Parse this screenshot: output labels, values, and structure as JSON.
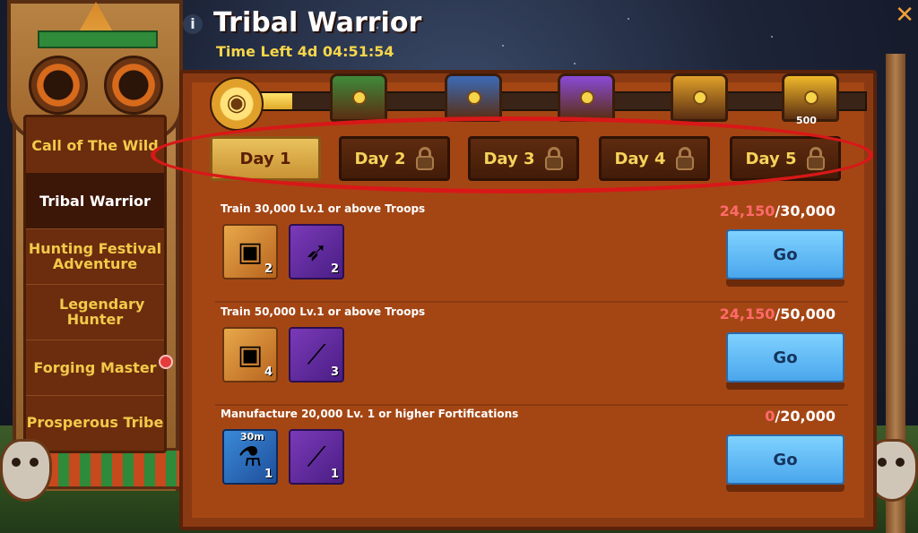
{
  "window": {
    "title": "Tribal Warrior",
    "time_left_label": "Time Left",
    "time_left_value": "4d 04:51:54",
    "close_label": "✕",
    "info_label": "i"
  },
  "sidebar": {
    "items": [
      {
        "label": "Call of The Wild",
        "active": false
      },
      {
        "label": "Tribal Warrior",
        "active": true
      },
      {
        "label": "Hunting Festival Adventure",
        "active": false
      },
      {
        "label": "Legendary Hunter",
        "active": false
      },
      {
        "label": "Forging Master",
        "active": false
      },
      {
        "label": "Prosperous Tribe",
        "active": false
      }
    ]
  },
  "progress": {
    "fill_fraction": 0.06,
    "chests": [
      {
        "name": "green-chest",
        "color": "#3f8a3a",
        "label": ""
      },
      {
        "name": "blue-chest",
        "color": "#3a6ab8",
        "label": ""
      },
      {
        "name": "purple-chest",
        "color": "#8a4ad8",
        "label": ""
      },
      {
        "name": "gold-chest",
        "color": "#e0a02a",
        "label": ""
      },
      {
        "name": "gold-chest-large",
        "color": "#f0b82a",
        "label": "500"
      }
    ]
  },
  "tabs": [
    {
      "label": "Day 1",
      "locked": false,
      "active": true
    },
    {
      "label": "Day 2",
      "locked": true,
      "active": false
    },
    {
      "label": "Day 3",
      "locked": true,
      "active": false
    },
    {
      "label": "Day 4",
      "locked": true,
      "active": false
    },
    {
      "label": "Day 5",
      "locked": true,
      "active": false
    }
  ],
  "tasks": [
    {
      "description": "Train 30,000 Lv.1 or above Troops",
      "current": "24,150",
      "target": "/30,000",
      "go_label": "Go",
      "rewards": [
        {
          "icon": "chest-icon",
          "style": "gold",
          "count": "2"
        },
        {
          "icon": "feather-icon",
          "style": "purple",
          "count": "2"
        }
      ]
    },
    {
      "description": "Train 50,000 Lv.1 or above Troops",
      "current": "24,150",
      "target": "/50,000",
      "go_label": "Go",
      "rewards": [
        {
          "icon": "chest-icon",
          "style": "gold",
          "count": "4"
        },
        {
          "icon": "wood-icon",
          "style": "purple",
          "count": "3"
        }
      ]
    },
    {
      "description": "Manufacture 20,000 Lv. 1 or higher Fortifications",
      "current": "0",
      "target": "/20,000",
      "go_label": "Go",
      "rewards": [
        {
          "icon": "speedup-potion-icon",
          "style": "blue",
          "count": "1",
          "badge": "30m"
        },
        {
          "icon": "wood-icon",
          "style": "purple",
          "count": "1"
        }
      ]
    }
  ],
  "colors": {
    "accent_gold": "#f6d35a",
    "progress_red": "#ff6a6a",
    "go_blue": "#4aa6ec",
    "highlight_red": "#d81818"
  }
}
